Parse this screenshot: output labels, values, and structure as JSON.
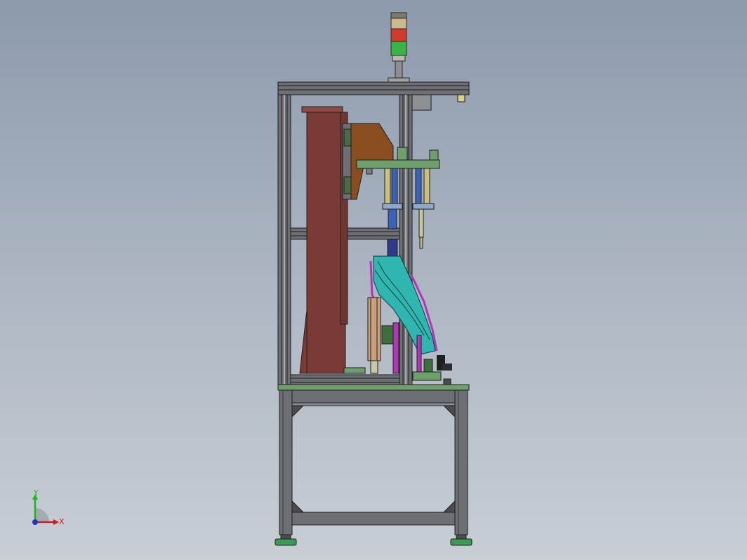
{
  "triad": {
    "x_label": "X",
    "y_label": "Y",
    "x_color": "#d01c1c",
    "y_color": "#1fb51f",
    "origin_color": "#2233cc"
  },
  "colors": {
    "frame": "#6c6f73",
    "frame_dark": "#2c2c2e",
    "base_plate": "#6f9f6c",
    "column_brown": "#7a3b36",
    "bracket_orange": "#8a4d1f",
    "fixture_cyan": "#2fb6b0",
    "accent_magenta": "#b236b8",
    "rod_blue": "#3c62b8",
    "light_red": "#d13b2a",
    "light_green": "#3ab545",
    "light_amber": "#c9b890"
  }
}
